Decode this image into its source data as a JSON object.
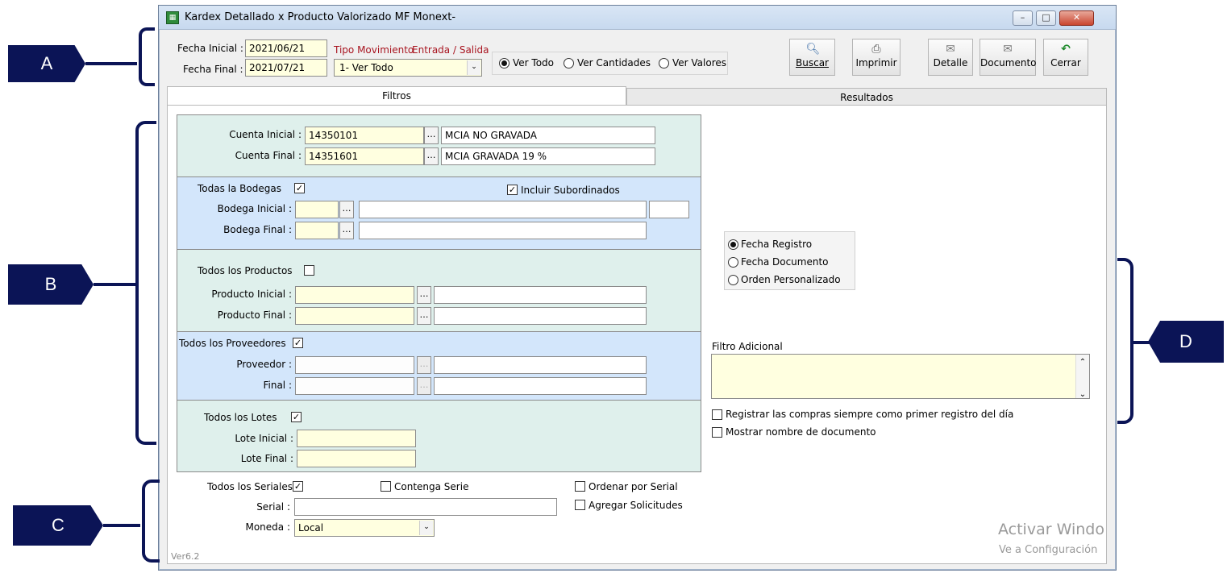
{
  "window": {
    "title": "Kardex Detallado x Producto Valorizado MF Monext-",
    "app_icon": "spreadsheet-icon"
  },
  "header": {
    "fecha_inicial_label": "Fecha Inicial :",
    "fecha_inicial_value": "2021/06/21",
    "fecha_final_label": "Fecha Final :",
    "fecha_final_value": "2021/07/21",
    "tipo_mov_label": "Tipo Movimiento",
    "entrada_salida_label": "Entrada / Salida",
    "tipo_mov_value": "1- Ver Todo",
    "radio_options": [
      "Ver Todo",
      "Ver Cantidades",
      "Ver Valores"
    ],
    "radio_selected": "Ver Todo"
  },
  "toolbar": {
    "buscar": "Buscar",
    "imprimir": "Imprimir",
    "detalle": "Detalle",
    "documento": "Documento",
    "cerrar": "Cerrar"
  },
  "tabs": [
    "Filtros",
    "Resultados"
  ],
  "cuenta": {
    "inicial_label": "Cuenta Inicial :",
    "inicial_value": "14350101",
    "inicial_desc": "MCIA NO GRAVADA",
    "final_label": "Cuenta Final :",
    "final_value": "14351601",
    "final_desc": "MCIA GRAVADA 19 %"
  },
  "bodega": {
    "todas_label": "Todas la Bodegas",
    "todas_checked": true,
    "incluir_label": "Incluir Subordinados",
    "incluir_checked": true,
    "inicial_label": "Bodega Inicial :",
    "final_label": "Bodega Final :"
  },
  "producto": {
    "todos_label": "Todos los Productos",
    "todos_checked": false,
    "inicial_label": "Producto Inicial :",
    "final_label": "Producto Final :"
  },
  "proveedor": {
    "todos_label": "Todos los Proveedores",
    "todos_checked": true,
    "proveedor_label": "Proveedor :",
    "final_label": "Final :"
  },
  "lote": {
    "todos_label": "Todos los Lotes",
    "todos_checked": true,
    "inicial_label": "Lote Inicial :",
    "final_label": "Lote Final :"
  },
  "serial": {
    "todos_label": "Todos los Seriales",
    "todos_checked": true,
    "contenga_label": "Contenga Serie",
    "ordenar_label": "Ordenar por Serial",
    "agregar_label": "Agregar Solicitudes",
    "serial_label": "Serial :",
    "moneda_label": "Moneda :",
    "moneda_value": "Local"
  },
  "fecha_options": {
    "items": [
      "Fecha Registro",
      "Fecha Documento",
      "Orden Personalizado"
    ],
    "selected": "Fecha Registro"
  },
  "filtro": {
    "label": "Filtro Adicional",
    "registrar_label": "Registrar las compras siempre como primer registro del día",
    "mostrar_label": "Mostrar nombre de documento"
  },
  "version": "Ver6.2",
  "watermark": {
    "line1": "Activar Windo",
    "line2": "Ve a Configuración"
  },
  "annotations": {
    "a": "A",
    "b": "B",
    "c": "C",
    "d": "D"
  },
  "colors": {
    "annotation": "#0b1456",
    "label_red": "#a8141f",
    "input_yellow": "#ffffe0",
    "section_green": "#dff0ec",
    "section_blue": "#d3e6fb"
  }
}
